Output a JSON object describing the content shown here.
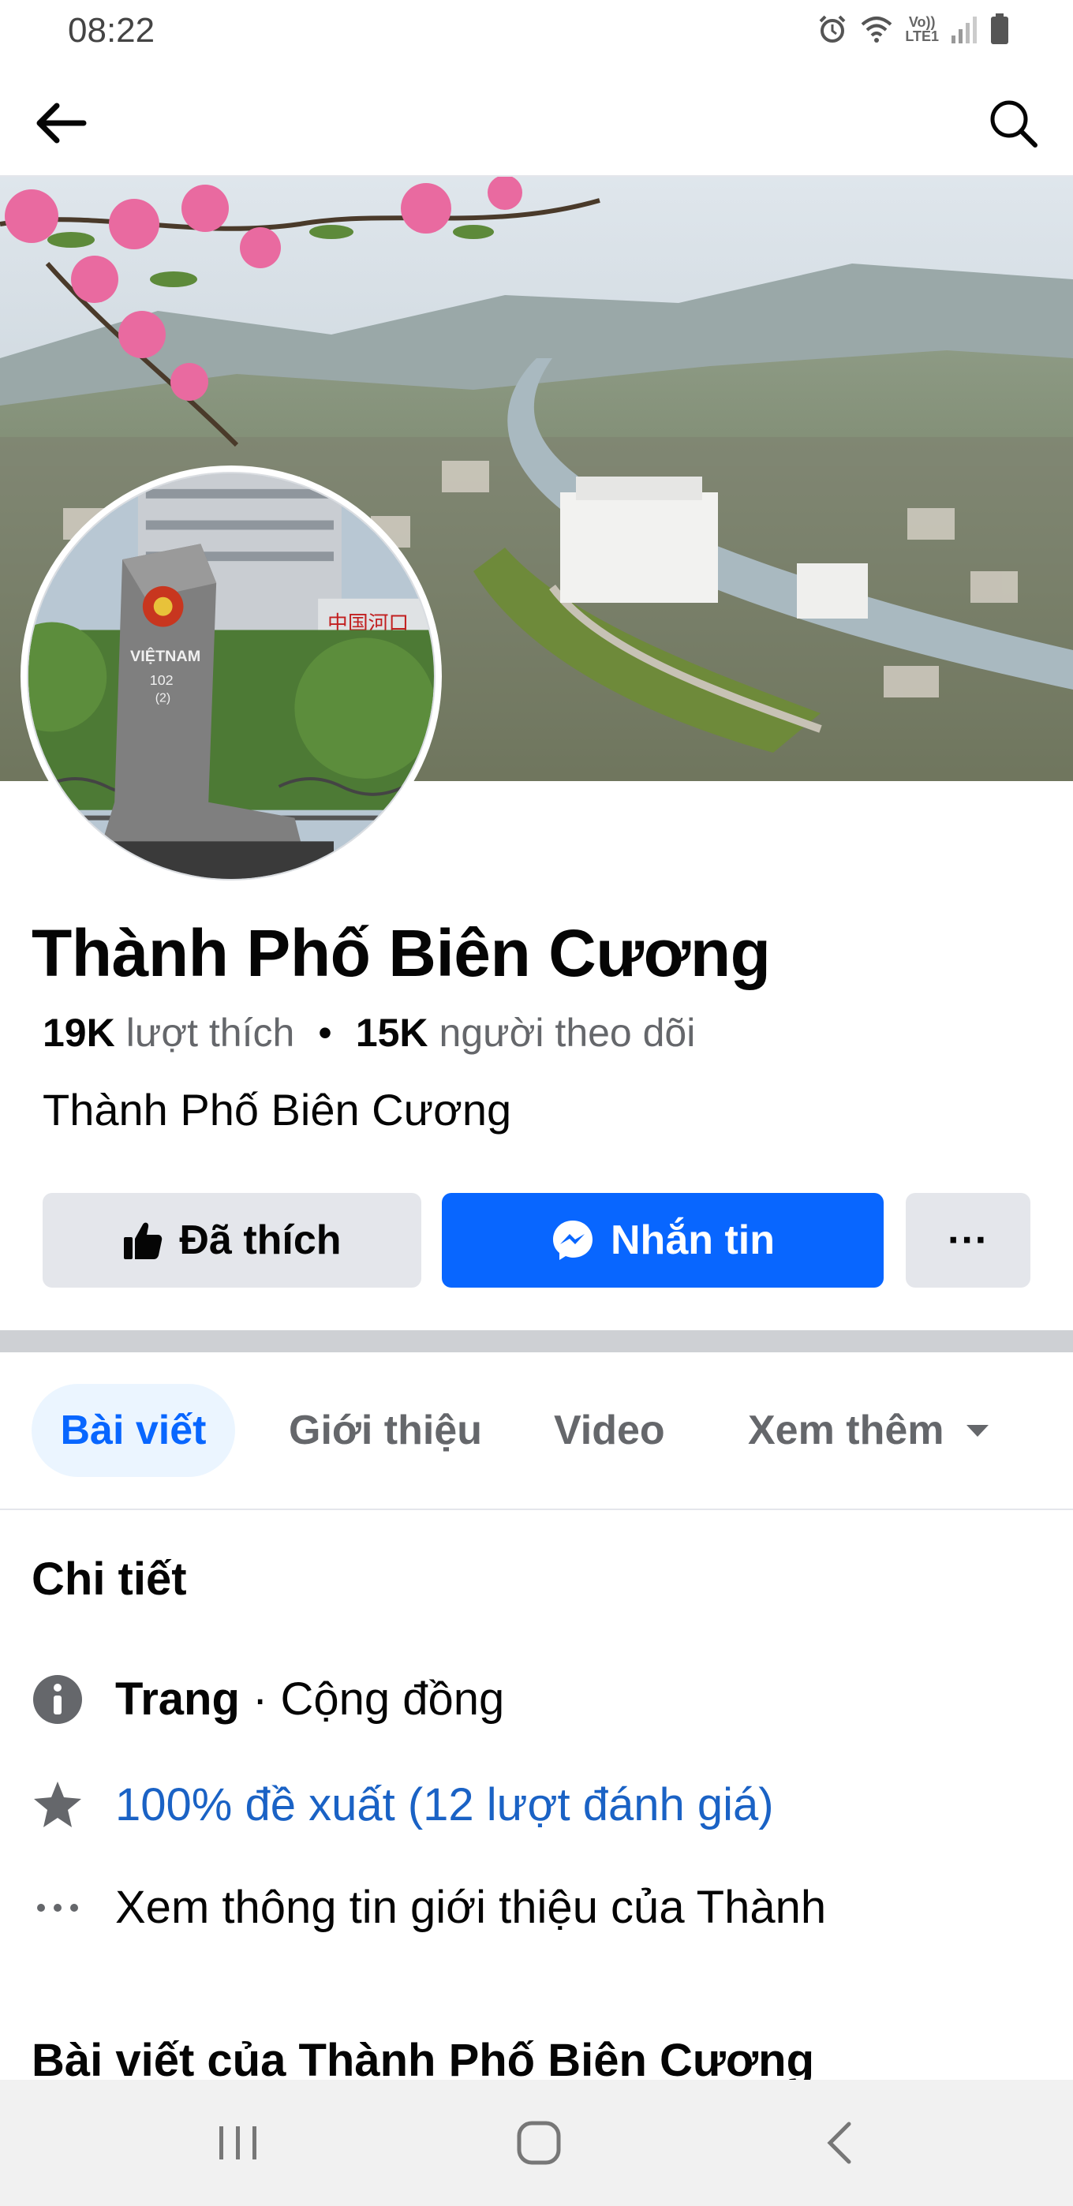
{
  "status_bar": {
    "time": "08:22",
    "network_label_top": "Vo))",
    "network_label_bottom": "LTE1",
    "icons": [
      "alarm-icon",
      "wifi-icon",
      "signal-icon",
      "battery-icon"
    ]
  },
  "nav": {
    "back_icon": "arrow-left-icon",
    "search_icon": "search-icon"
  },
  "cover": {
    "description_icon": "landscape-photo"
  },
  "profile": {
    "marker_country": "VIỆTNAM",
    "marker_number": "102",
    "marker_sub": "(2)",
    "sign_text": "中国河口"
  },
  "page": {
    "name": "Thành Phố Biên Cương",
    "likes_count": "19K",
    "likes_label": "lượt thích",
    "separator": "•",
    "followers_count": "15K",
    "followers_label": "người theo dõi",
    "category": "Thành Phố Biên Cương"
  },
  "actions": {
    "liked_label": "Đã thích",
    "message_label": "Nhắn tin",
    "more_label": "···"
  },
  "tabs": {
    "posts": "Bài viết",
    "about": "Giới thiệu",
    "video": "Video",
    "more": "Xem thêm"
  },
  "details": {
    "title": "Chi tiết",
    "type_bold": "Trang",
    "type_rest": " · Cộng đồng",
    "rating": "100% đề xuất (12 lượt đánh giá)",
    "about_link": "Xem thông tin giới thiệu của Thành",
    "posts_title": "Bài viết của Thành Phố Biên Cương"
  },
  "colors": {
    "accent": "#0866ff",
    "link": "#1a62c5",
    "secondary_text": "#65676b",
    "button_gray": "#e4e6eb",
    "active_tab_bg": "#ebf5ff"
  }
}
